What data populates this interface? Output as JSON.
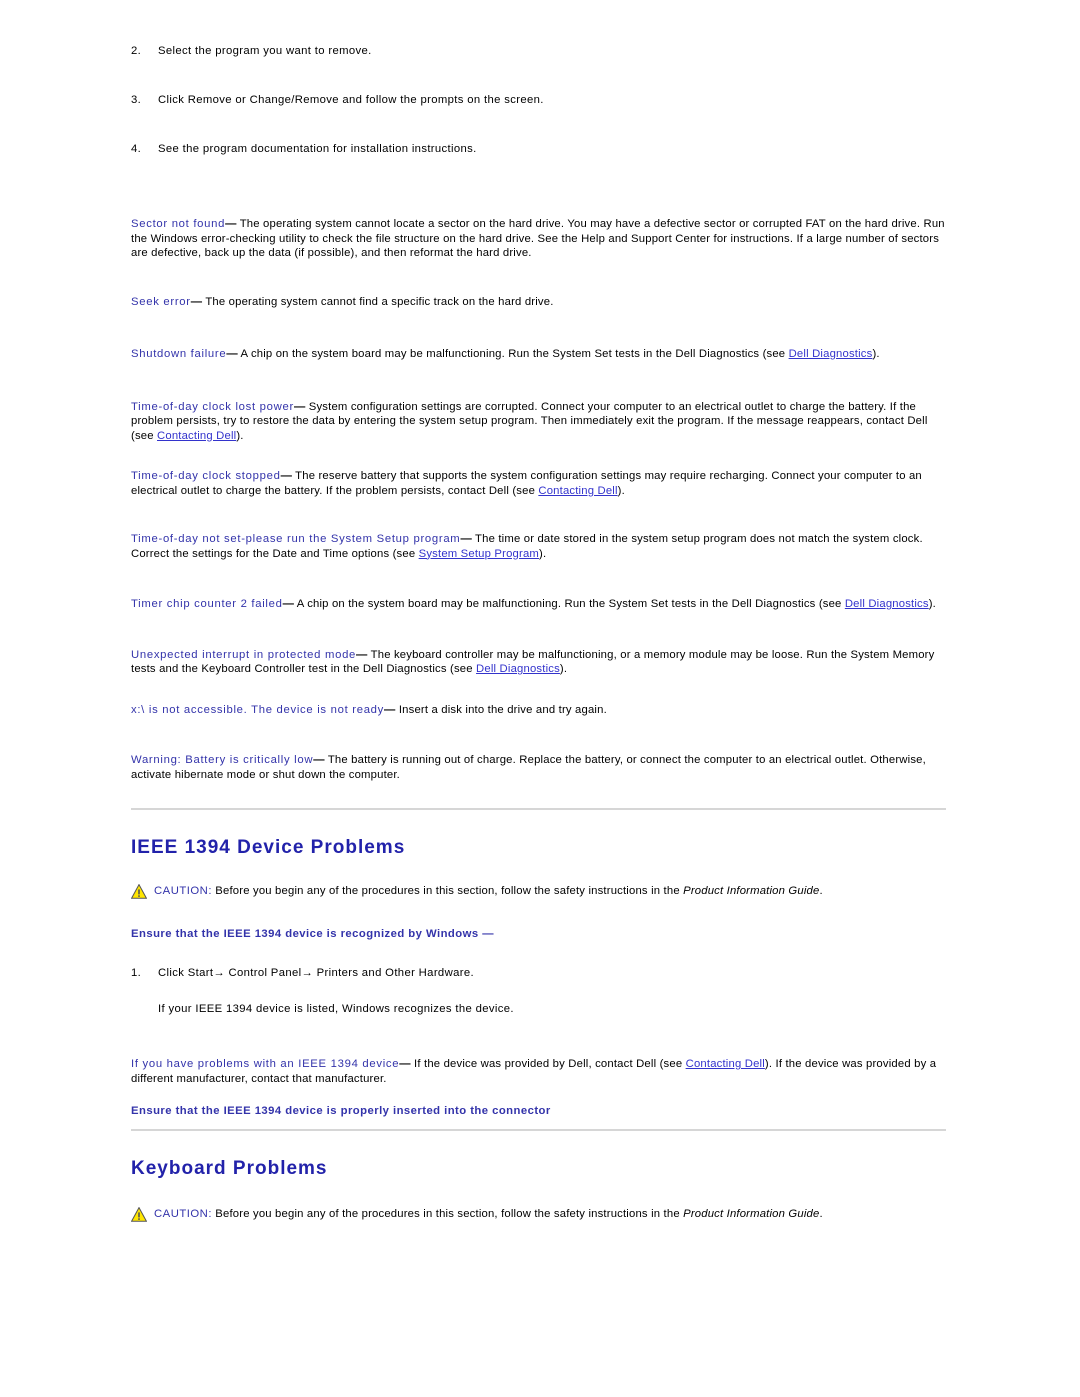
{
  "colors": {
    "heading_blue": "#2222AA",
    "term_blue": "#3333AA",
    "link_blue": "#3333CC",
    "rule_gray": "#d6d6d6",
    "caution_yellow": "#FFE600",
    "body_black": "#000000"
  },
  "steps_top": [
    {
      "num": "2.",
      "text": "Select the program you want to remove."
    },
    {
      "num": "3.",
      "text": "Click Remove or Change/Remove and follow the prompts on the screen."
    },
    {
      "num": "4.",
      "text": "See the program documentation for installation instructions."
    }
  ],
  "messages": [
    {
      "term": "Sector not found",
      "dash": "—",
      "body": " The operating system cannot locate a sector on the hard drive. You may have a defective sector or corrupted FAT on the hard drive. Run the Windows error-checking utility to check the file structure on the hard drive. See the Help and Support Center for instructions. If a large number of sectors are defective, back up the data (if possible), and then reformat the hard drive."
    },
    {
      "term": "Seek error",
      "dash": "—",
      "body": " The operating system cannot find a specific track on the hard drive."
    },
    {
      "term": "Shutdown failure",
      "dash": "—",
      "body_pre": " A chip on the system board may be malfunctioning. Run the System Set tests in the Dell Diagnostics (see ",
      "link": "Dell Diagnostics",
      "body_post": ")."
    },
    {
      "term": "Time-of-day clock lost power",
      "dash": "—",
      "body_pre": " System configuration settings are corrupted. Connect your computer to an electrical outlet to charge the battery. If the problem persists, try to restore the data by entering the system setup program. Then immediately exit the program. If the message reappears, contact Dell (see ",
      "link": "Contacting Dell",
      "body_post": ")."
    },
    {
      "term": "Time-of-day clock stopped",
      "dash": "—",
      "body_pre": " The reserve battery that supports the system configuration settings may require recharging. Connect your computer to an electrical outlet to charge the battery. If the problem persists, contact Dell (see ",
      "link": "Contacting Dell",
      "body_post": ")."
    },
    {
      "term": "Time-of-day not set-please run the System Setup program",
      "dash": "—",
      "body_pre": " The time or date stored in the system setup program does not match the system clock. Correct the settings for the Date and Time options (see ",
      "link": "System Setup Program",
      "body_post": ")."
    },
    {
      "term": "Timer chip counter 2 failed",
      "dash": "—",
      "body_pre": " A chip on the system board may be malfunctioning. Run the System Set tests in the Dell Diagnostics (see ",
      "link": "Dell Diagnostics",
      "body_post": ")."
    },
    {
      "term": "Unexpected interrupt in protected mode",
      "dash": "—",
      "body_pre": " The keyboard controller may be malfunctioning, or a memory module may be loose. Run the System Memory tests and the Keyboard Controller test in the Dell Diagnostics (see ",
      "link": "Dell Diagnostics",
      "body_post": ")."
    },
    {
      "term": "x:\\ is not accessible. The device is not ready",
      "dash": "—",
      "body": " Insert a disk into the drive and try again."
    },
    {
      "term": "Warning: Battery is critically low",
      "dash": "—",
      "body": " The battery is running out of charge. Replace the battery, or connect the computer to an electrical outlet. Otherwise, activate hibernate mode or shut down the computer."
    }
  ],
  "ieee_section": {
    "title": "IEEE 1394 Device Problems",
    "caution": {
      "icon": "caution-triangle-icon",
      "label": "CAUTION:",
      "text_pre": " Before you begin any of the procedures in this section, follow the safety instructions in the ",
      "text_italic": "Product Information Guide",
      "text_post": "."
    },
    "lead_1": "Ensure that the IEEE 1394 device is recognized by Windows —",
    "step_1": {
      "num": "1.",
      "text": "Click Start→ Control Panel→ Printers and Other Hardware."
    },
    "step_1_note": "If your IEEE 1394 device is listed, Windows recognizes the device.",
    "problem_msg": {
      "term": "If you have problems with an IEEE 1394 device",
      "dash": "—",
      "body_pre": " If the device was provided by Dell, contact Dell (see ",
      "link": "Contacting Dell",
      "body_post": "). If the device was provided by a different manufacturer, contact that manufacturer."
    },
    "lead_2": "Ensure that the IEEE 1394 device is properly inserted into the connector"
  },
  "keyboard_section": {
    "title": "Keyboard Problems",
    "caution": {
      "icon": "caution-triangle-icon",
      "label": "CAUTION:",
      "text_pre": " Before you begin any of the procedures in this section, follow the safety instructions in the ",
      "text_italic": "Product Information Guide",
      "text_post": "."
    }
  }
}
